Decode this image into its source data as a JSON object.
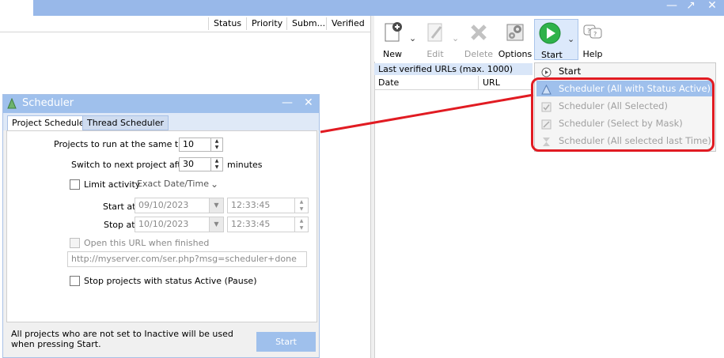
{
  "main_list": {
    "columns": [
      "Status",
      "Priority",
      "Subm...",
      "Verified"
    ]
  },
  "toolbar": {
    "new_label": "New",
    "edit_label": "Edit",
    "delete_label": "Delete",
    "options_label": "Options",
    "start_label": "Start",
    "help_label": "Help"
  },
  "verified_pane": {
    "title": "Last verified URLs (max. 1000)",
    "col_date": "Date",
    "col_url": "URL"
  },
  "start_menu": {
    "items": [
      {
        "label": "Start",
        "icon": "play-circle-icon"
      },
      {
        "label": "Scheduler (All with Status Active)",
        "icon": "scheduler-icon"
      },
      {
        "label": "Scheduler (All Selected)",
        "icon": "checked-list-icon"
      },
      {
        "label": "Scheduler (Select by Mask)",
        "icon": "mask-edit-icon"
      },
      {
        "label": "Scheduler (All  selected last Time)",
        "icon": "hourglass-icon"
      }
    ]
  },
  "scheduler": {
    "title": "Scheduler",
    "tabs": [
      "Project Scheduler",
      "Thread Scheduler"
    ],
    "projects_same_time_label": "Projects to run at the same time",
    "projects_same_time_value": "10",
    "switch_next_label": "Switch to next project after",
    "switch_next_value": "30",
    "switch_next_unit": "minutes",
    "limit_activity_label": "Limit activity",
    "limit_activity_mode": "Exact Date/Time",
    "start_at_label": "Start at",
    "start_at_date": "09/10/2023",
    "start_at_time": "12:33:45",
    "stop_at_label": "Stop at",
    "stop_at_date": "10/10/2023",
    "stop_at_time": "12:33:45",
    "open_url_label": "Open this URL when finished",
    "open_url_value": "http://myserver.com/ser.php?msg=scheduler+done",
    "stop_projects_label": "Stop projects with status Active (Pause)",
    "footer_note": "All projects who are not set to Inactive will be used when pressing Start.",
    "start_button": "Start"
  },
  "colors": {
    "titlebar": "#98b8e9",
    "highlight": "#9fc0ec",
    "annotation_red": "#e11b22",
    "start_green": "#2fb24a"
  }
}
